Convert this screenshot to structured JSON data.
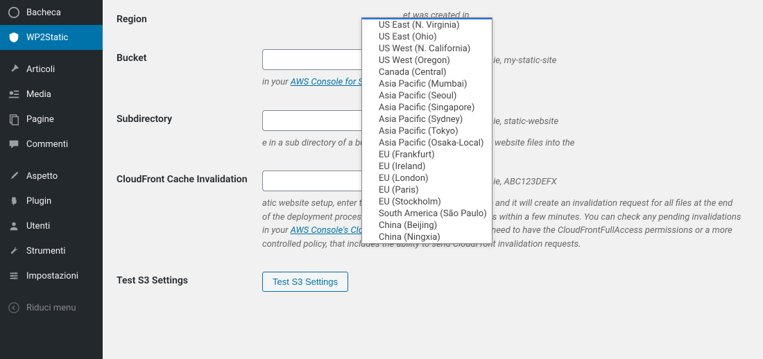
{
  "sidebar": {
    "items": [
      {
        "label": "Bacheca",
        "icon": "dashboard-icon"
      },
      {
        "label": "WP2Static",
        "icon": "shield-icon",
        "active": true
      },
      {
        "label": "Articoli",
        "icon": "pin-icon"
      },
      {
        "label": "Media",
        "icon": "media-icon"
      },
      {
        "label": "Pagine",
        "icon": "pages-icon"
      },
      {
        "label": "Commenti",
        "icon": "comment-icon"
      },
      {
        "label": "Aspetto",
        "icon": "brush-icon"
      },
      {
        "label": "Plugin",
        "icon": "plug-icon"
      },
      {
        "label": "Utenti",
        "icon": "user-icon"
      },
      {
        "label": "Strumenti",
        "icon": "wrench-icon"
      },
      {
        "label": "Impostazioni",
        "icon": "settings-icon"
      },
      {
        "label": "Riduci menu",
        "icon": "collapse-icon",
        "dim": true
      }
    ]
  },
  "form": {
    "region": {
      "label": "Region",
      "hint": "et was created in",
      "options": [
        "",
        "US East (N. Virginia)",
        "US East (Ohio)",
        "US West (N. California)",
        "US West (Oregon)",
        "Canada (Central)",
        "Asia Pacific (Mumbai)",
        "Asia Pacific (Seoul)",
        "Asia Pacific (Singapore)",
        "Asia Pacific (Sydney)",
        "Asia Pacific (Tokyo)",
        "Asia Pacific (Osaka-Local)",
        "EU (Frankfurt)",
        "EU (Ireland)",
        "EU (London)",
        "EU (Paris)",
        "EU (Stockholm)",
        "South America (São Paulo)",
        "China (Beijing)",
        "China (Ningxia)"
      ]
    },
    "bucket": {
      "label": "Bucket",
      "hint": "ie, my-static-site",
      "desc_prefix": "in your ",
      "link": "AWS Console for S3",
      "desc_suffix": "."
    },
    "subdirectory": {
      "label": "Subdirectory",
      "hint": "ie, static-website",
      "desc": "e in a sub directory of a bucket, this will deploy all the static website files into the"
    },
    "cloudfront": {
      "label": "CloudFront Cache Invalidation",
      "hint": "ie, ABC123DEFX",
      "desc_prefix": "atic website setup, enter the CloudFront Distribution ID here and it will create an invalidation request for all files at the end of the deployment process. The invalidation usually happens within a few minutes. You can check any pending invalidations in your ",
      "link": "AWS Console's CloudFront page",
      "desc_suffix": ". You AWS user will need to have the CloudFrontFullAccess permissions or a more controlled policy, that includes the ability to send CloudFront invalidation requests."
    },
    "test": {
      "label": "Test S3 Settings",
      "button": "Test S3 Settings"
    }
  }
}
